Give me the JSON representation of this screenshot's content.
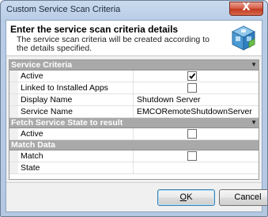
{
  "window": {
    "title": "Custom Service Scan Criteria",
    "close_glyph": "X"
  },
  "header": {
    "title": "Enter the service scan criteria details",
    "description": "The service scan criteria will be created according to the details specified.",
    "icon": "service-cube-icon"
  },
  "grid": {
    "categories": [
      {
        "label": "Service Criteria",
        "rows": [
          {
            "name": "Active",
            "type": "checkbox",
            "checked": true
          },
          {
            "name": "Linked to Installed Apps",
            "type": "checkbox",
            "checked": false
          },
          {
            "name": "Display Name",
            "type": "text",
            "value": "Shutdown Server"
          },
          {
            "name": "Service Name",
            "type": "text",
            "value": "EMCORemoteShutdownServer"
          }
        ]
      },
      {
        "label": "Fetch Service State to result",
        "rows": [
          {
            "name": "Active",
            "type": "checkbox",
            "checked": false
          }
        ]
      },
      {
        "label": "Match Data",
        "rows": [
          {
            "name": "Match",
            "type": "checkbox",
            "checked": false
          },
          {
            "name": "State",
            "type": "text",
            "value": ""
          }
        ]
      }
    ]
  },
  "buttons": {
    "ok_mnemonic": "O",
    "ok_rest": "K",
    "cancel_label": "Cancel"
  },
  "colors": {
    "category_bg": "#a9a9a9",
    "title_bar": "#b9cde6",
    "close_button": "#c23a22"
  }
}
